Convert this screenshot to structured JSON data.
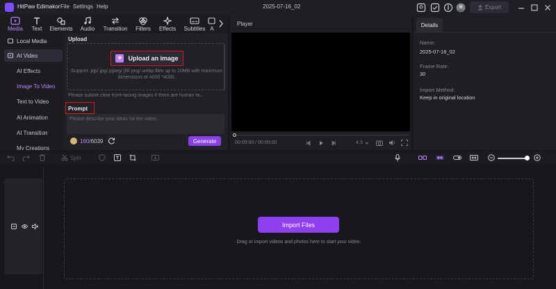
{
  "app": {
    "name": "HitPaw Edimakor",
    "project_title": "2025-07-16_02"
  },
  "menu": [
    "File",
    "Settings",
    "Help"
  ],
  "export_label": "Export",
  "tool_tabs": [
    {
      "label": "Media",
      "icon": "media-icon"
    },
    {
      "label": "Text",
      "icon": "text-icon"
    },
    {
      "label": "Elements",
      "icon": "elements-icon"
    },
    {
      "label": "Audio",
      "icon": "audio-icon"
    },
    {
      "label": "Transition",
      "icon": "transition-icon"
    },
    {
      "label": "Filters",
      "icon": "filters-icon"
    },
    {
      "label": "Effects",
      "icon": "effects-icon"
    },
    {
      "label": "Subtitles",
      "icon": "subtitles-icon"
    },
    {
      "label": "A",
      "icon": "ai-icon"
    }
  ],
  "sidebar": {
    "local_media": "Local Media",
    "ai_video": "AI Video",
    "sub_items": [
      "AI Effects",
      "Image To Video",
      "Text to Video",
      "AI Animation",
      "AI Transition",
      "My Creations"
    ]
  },
  "upload": {
    "section_label": "Upload",
    "button_label": "Upload an image",
    "hint": "Support .pjp/.jpg/.pjpeg/.jfif/.png/.webp files up to 20MB with maximum dimensions of 4000 *4000.",
    "face_note": "Please submit clear front-facing images if there are human fa..."
  },
  "prompt": {
    "label": "Prompt",
    "placeholder": "Please describe your ideas for the video.",
    "credits_used": "160",
    "credits_total": "/6039",
    "generate_label": "Generate"
  },
  "player": {
    "title": "Player",
    "timecode": "00:00:00 / 00:00:00",
    "aspect": "4:3"
  },
  "details": {
    "tab": "Details",
    "name_label": "Name:",
    "name_value": "2025-07-16_02",
    "frame_rate_label": "Frame Rate:",
    "frame_rate_value": "30",
    "import_method_label": "Import Method:",
    "import_method_value": "Keep in original location"
  },
  "timeline": {
    "split_label": "Split",
    "import_label": "Import Files",
    "drop_hint": "Drag or import videos and photos here to start your video.",
    "zoom_level": 0.85
  },
  "colors": {
    "accent": "#8f3ff0",
    "highlight_box": "#e0161d",
    "active_text": "#b58bff"
  }
}
